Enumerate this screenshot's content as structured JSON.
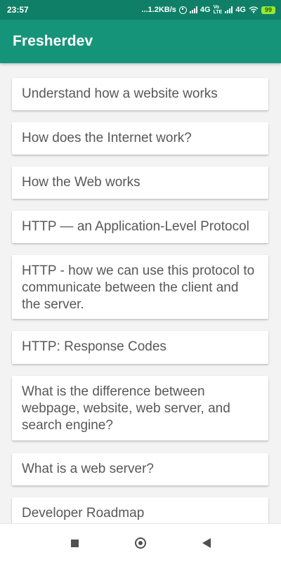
{
  "status_bar": {
    "time": "23:57",
    "network_speed": "...1.2KB/s",
    "alarm_icon": "alarm-icon",
    "network_1": "4G",
    "volte": "Vo\nLTE",
    "network_2": "4G",
    "battery": "99",
    "wifi_icon": "wifi-icon"
  },
  "app_bar": {
    "title": "Fresherdev"
  },
  "list": {
    "items": [
      {
        "label": "Understand how a website works"
      },
      {
        "label": "How does the Internet work?"
      },
      {
        "label": "How the Web works"
      },
      {
        "label": "HTTP — an Application-Level Protocol"
      },
      {
        "label": "HTTP - how we can use this protocol to communicate between the client and the server."
      },
      {
        "label": "HTTP: Response Codes"
      },
      {
        "label": "What is the difference between webpage, website, web server, and search engine?"
      },
      {
        "label": "What is a web server?"
      },
      {
        "label": "Developer Roadmap"
      }
    ]
  },
  "navigation": {
    "recents_icon": "square-icon",
    "home_icon": "home-icon",
    "back_icon": "back-icon"
  },
  "colors": {
    "status_bar": "#0f7f67",
    "app_bar": "#169479",
    "background": "#f3f3f3",
    "card": "#ffffff",
    "text": "#585858",
    "battery": "#9be82f"
  }
}
